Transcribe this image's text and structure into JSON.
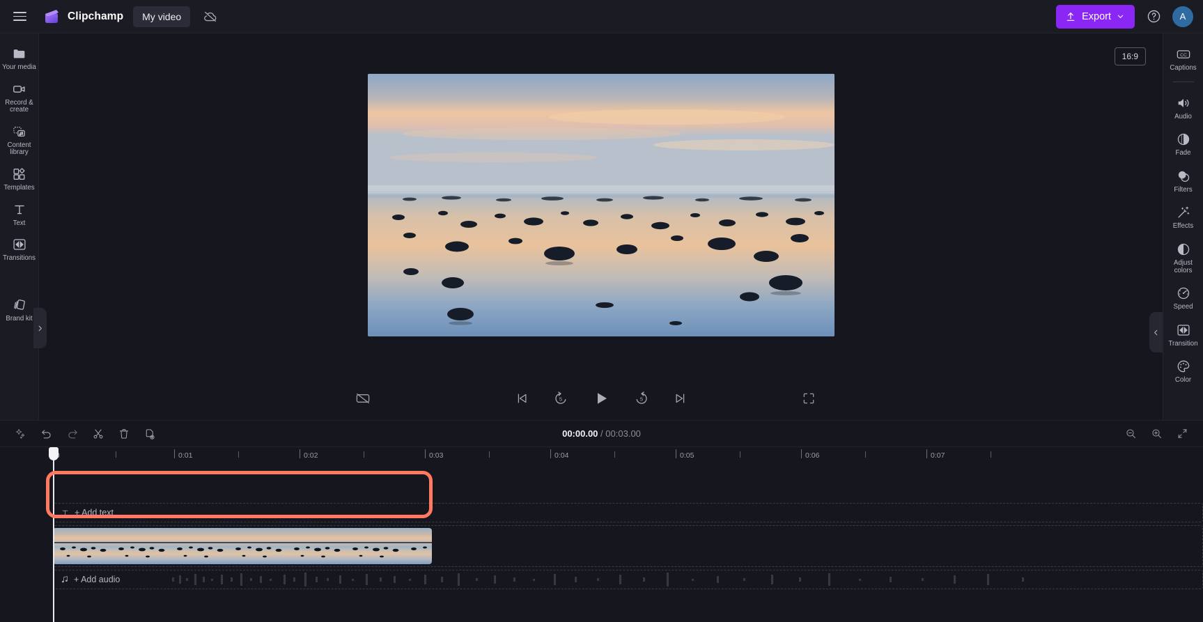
{
  "app": {
    "brand": "Clipchamp",
    "project_title": "My video",
    "menu_icon": "hamburger-icon",
    "cloud_icon": "cloud-off-icon"
  },
  "topbar": {
    "export_label": "Export",
    "export_color": "#8b27f5",
    "help_icon": "question-circle-icon",
    "avatar_initial": "A",
    "avatar_color": "#2f6ba1"
  },
  "left_rail": {
    "items": [
      {
        "label": "Your media",
        "icon": "folder-icon"
      },
      {
        "label": "Record & create",
        "icon": "video-camera-icon"
      },
      {
        "label": "Content library",
        "icon": "content-library-icon"
      },
      {
        "label": "Templates",
        "icon": "templates-icon"
      },
      {
        "label": "Text",
        "icon": "text-t-icon"
      },
      {
        "label": "Transitions",
        "icon": "transitions-icon"
      },
      {
        "label": "Brand kit",
        "icon": "brand-kit-icon"
      }
    ],
    "expand_icon": "chevron-right-icon"
  },
  "right_rail": {
    "items": [
      {
        "label": "Captions",
        "icon": "captions-cc-icon"
      },
      {
        "label": "Audio",
        "icon": "speaker-icon"
      },
      {
        "label": "Fade",
        "icon": "fade-icon"
      },
      {
        "label": "Filters",
        "icon": "filters-icon"
      },
      {
        "label": "Effects",
        "icon": "effects-wand-icon"
      },
      {
        "label": "Adjust colors",
        "icon": "adjust-colors-icon"
      },
      {
        "label": "Speed",
        "icon": "speed-gauge-icon"
      },
      {
        "label": "Transition",
        "icon": "transition-icon"
      },
      {
        "label": "Color",
        "icon": "color-palette-icon"
      }
    ],
    "collapse_icon": "chevron-left-icon"
  },
  "player": {
    "aspect_ratio": "16:9",
    "controls": [
      {
        "name": "captions-off-button",
        "icon": "captions-off-icon"
      },
      {
        "name": "skip-to-start-button",
        "icon": "skip-previous-icon"
      },
      {
        "name": "rewind-5-button",
        "icon": "rewind-5-icon"
      },
      {
        "name": "play-button",
        "icon": "play-icon"
      },
      {
        "name": "forward-5-button",
        "icon": "forward-5-icon"
      },
      {
        "name": "skip-to-end-button",
        "icon": "skip-next-icon"
      },
      {
        "name": "fullscreen-button",
        "icon": "fullscreen-icon"
      }
    ]
  },
  "timeline": {
    "tools": [
      {
        "name": "magic-suggest-button",
        "icon": "sparkle-icon"
      },
      {
        "name": "undo-button",
        "icon": "undo-arrow-icon"
      },
      {
        "name": "redo-button",
        "icon": "redo-arrow-icon"
      },
      {
        "name": "split-button",
        "icon": "scissors-icon"
      },
      {
        "name": "delete-button",
        "icon": "trash-icon"
      },
      {
        "name": "duplicate-button",
        "icon": "duplicate-icon"
      }
    ],
    "current_time": "00:00.00",
    "separator": "/",
    "total_time": "00:03.00",
    "zoom_controls": [
      {
        "name": "zoom-out-button",
        "icon": "zoom-out-icon"
      },
      {
        "name": "zoom-in-button",
        "icon": "zoom-in-icon"
      },
      {
        "name": "fit-timeline-button",
        "icon": "fit-to-screen-icon"
      }
    ],
    "collapse_icon": "chevron-down-icon",
    "ruler_labels": [
      "0",
      "0:01",
      "0:02",
      "0:03",
      "0:04",
      "0:05",
      "0:06",
      "0:07"
    ],
    "playhead_time": "0",
    "tracks": [
      {
        "name": "text-track",
        "hint": "+ Add text",
        "icon": "text-t-icon"
      },
      {
        "name": "video-track",
        "hint": "",
        "icon": ""
      },
      {
        "name": "audio-track",
        "hint": "+ Add audio",
        "icon": "music-note-icon"
      }
    ],
    "selected_clip": {
      "name": "video-clip",
      "highlight_color": "#ff7a60",
      "start": "0:00",
      "end": "0:03"
    }
  }
}
